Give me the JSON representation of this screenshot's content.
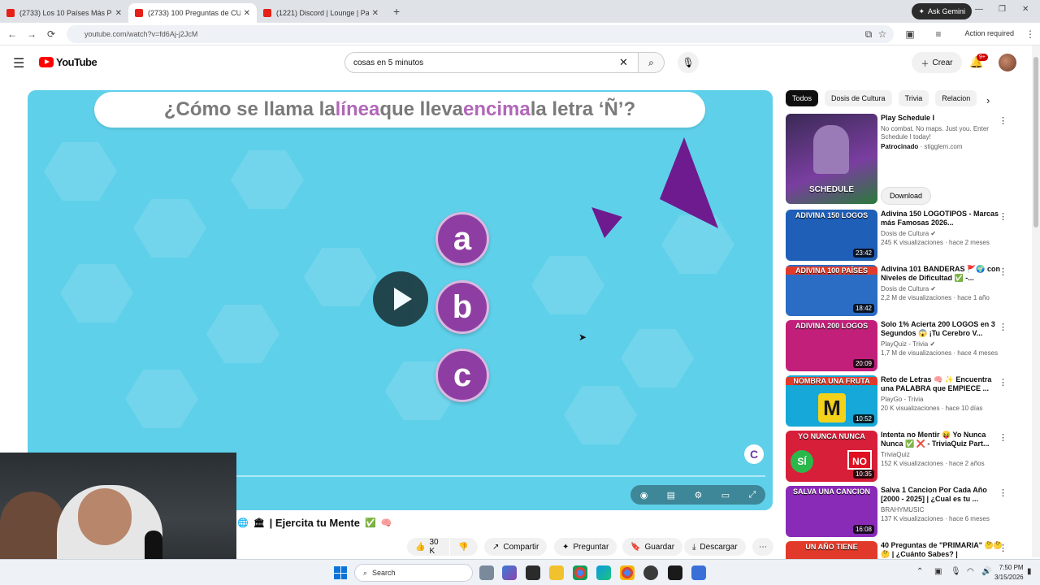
{
  "browser": {
    "tabs": [
      {
        "title": "(2733) Los 10 Países Más Peligr",
        "favicon_color": "#e62117",
        "active": false
      },
      {
        "title": "(2733) 100 Preguntas de CU",
        "favicon_color": "#e62117",
        "active": true
      },
      {
        "title": "(1221) Discord | Lounge | Pa",
        "favicon_color": "#e62117",
        "active": false
      }
    ],
    "gemini_label": "Ask Gemini",
    "url": "youtube.com/watch?v=fd6Aj-j2JcM",
    "action_required": "Action required"
  },
  "youtube": {
    "logo_text": "YouTube",
    "search_value": "cosas en 5 minutos",
    "create_label": "Crear",
    "notifications_badge": "9+",
    "accent_color": "#ff0000"
  },
  "video": {
    "question_parts": [
      "¿Cómo se llama la ",
      "línea",
      " que lleva ",
      "encima",
      " la letra ‘Ñ’?"
    ],
    "options": [
      "a",
      "b",
      "c"
    ],
    "channel_badge": "C",
    "title": "| Ejercita tu Mente",
    "likes": "30 K",
    "share_label": "Compartir",
    "ask_label": "Preguntar",
    "save_label": "Guardar",
    "download_label": "Descargar"
  },
  "sidebar": {
    "chips": [
      "Todos",
      "Dosis de Cultura",
      "Trivia",
      "Relacion"
    ],
    "ad": {
      "title": "Play Schedule I",
      "desc": "No combat. No maps. Just you. Enter Schedule I today!",
      "sponsored": "Patrocinado",
      "domain": "· stigglem.com",
      "thumb_text": "SCHEDULE",
      "button": "Download"
    },
    "videos": [
      {
        "title": "Adivina 150 LOGOTIPOS - Marcas más Famosas 2026...",
        "channel": "Dosis de Cultura",
        "stats": "245 K visualizaciones · hace 2 meses",
        "duration": "23:42",
        "thumb_text": "ADIVINA 150 LOGOS",
        "color": "#1f5fb7"
      },
      {
        "title": "Adivina 101 BANDERAS 🚩🌍 con Niveles de Dificultad ✅ -...",
        "channel": "Dosis de Cultura",
        "stats": "2,2 M de visualizaciones · hace 1 año",
        "duration": "18:42",
        "thumb_text": "ADIVINA 100 PAÍSES",
        "color": "#2b6cc4"
      },
      {
        "title": "Solo 1% Acierta 200 LOGOS en 3 Segundos 😱 ¡Tu Cerebro V...",
        "channel": "PlayQuiz - Trivia",
        "stats": "1,7 M de visualizaciones · hace 4 meses",
        "duration": "20:09",
        "thumb_text": "ADIVINA 200 LOGOS",
        "color": "#c21f7a"
      },
      {
        "title": "Reto de Letras 🧠 ✨ Encuentra una PALABRA que EMPIECE ...",
        "channel": "PlayGo - Trivia",
        "stats": "20 K visualizaciones · hace 10 días",
        "duration": "10:52",
        "thumb_text": "NOMBRA UNA FRUTA",
        "color": "#16a8d8"
      },
      {
        "title": "Intenta no Mentir 😝 Yo Nunca Nunca ✅ ❌ - TriviaQuiz Part...",
        "channel": "TriviaQuiz",
        "stats": "152 K visualizaciones · hace 2 años",
        "duration": "10:35",
        "thumb_text": "YO NUNCA NUNCA",
        "color": "#d81f3a"
      },
      {
        "title": "Salva 1 Cancion Por Cada Año [2000 - 2025] | ¿Cual es tu ...",
        "channel": "BRAHYMUSIC",
        "stats": "137 K visualizaciones · hace 6 meses",
        "duration": "16:08",
        "thumb_text": "SALVA UNA CANCION",
        "color": "#8a2bb8"
      },
      {
        "title": "40 Preguntas de \"PRIMARIA\" 🤔🤔🤔 | ¿Cuánto Sabes? |",
        "channel": "",
        "stats": "",
        "duration": "",
        "thumb_text": "UN AÑO TIENE",
        "color": "#e23a2a"
      }
    ]
  },
  "taskbar": {
    "search_label": "Search",
    "time": "7:50 PM",
    "date": "3/15/2026"
  }
}
